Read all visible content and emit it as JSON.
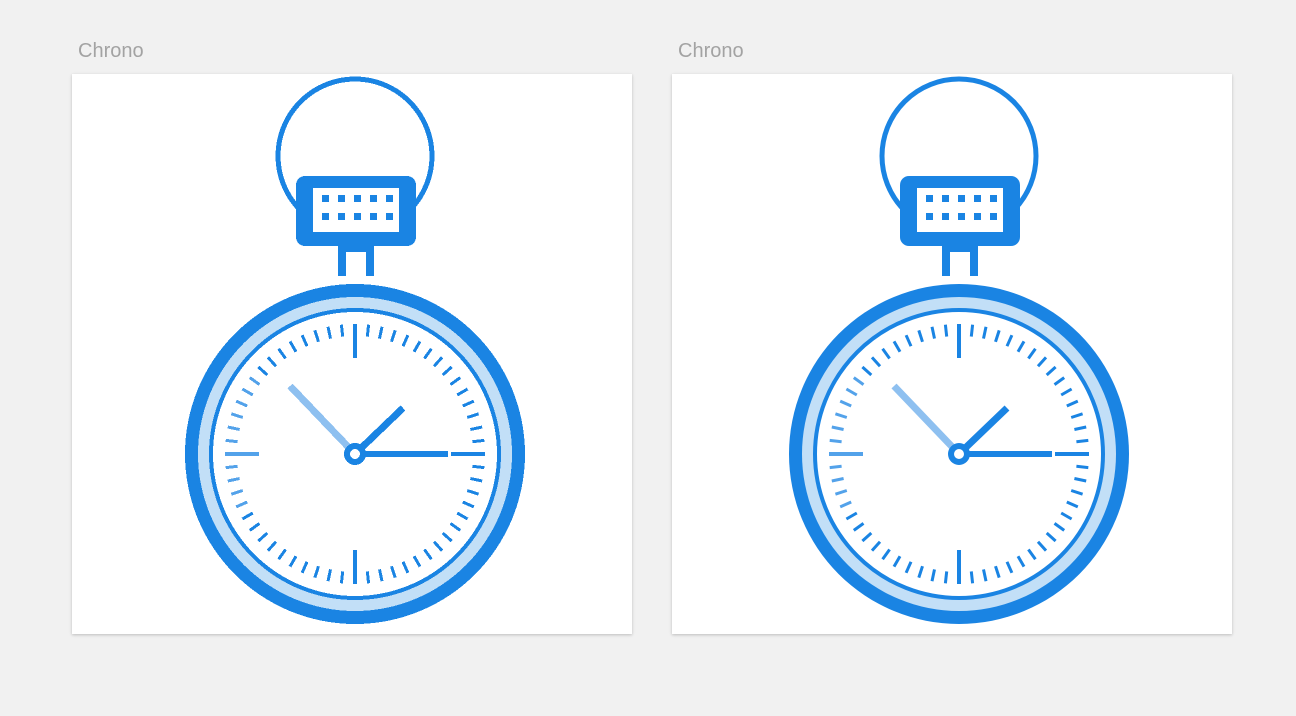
{
  "canvas": {
    "background": "#f1f1f1",
    "artboard_fill": "#ffffff"
  },
  "artboards": [
    {
      "title": "Chrono",
      "icon": "stopwatch-icon",
      "rendering": "pixelated"
    },
    {
      "title": "Chrono",
      "icon": "stopwatch-icon",
      "rendering": "pixelated"
    }
  ],
  "colors": {
    "primary": "#1a84e3",
    "ring_light": "#c2dff7",
    "hand_light": "#8ec0f0",
    "label": "#a3a3a3"
  }
}
